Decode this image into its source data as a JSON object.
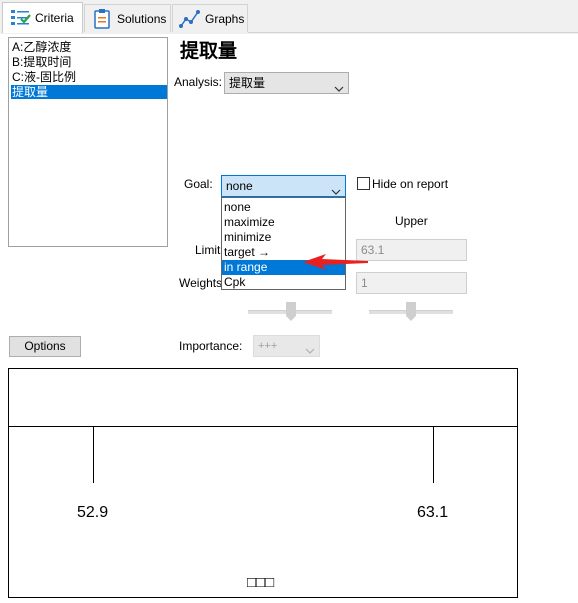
{
  "tabs": [
    {
      "label": "Criteria",
      "icon": "criteria-list-icon",
      "selected": true
    },
    {
      "label": "Solutions",
      "icon": "clipboard-icon",
      "selected": false
    },
    {
      "label": "Graphs",
      "icon": "line-graph-icon",
      "selected": false
    }
  ],
  "factors": [
    {
      "label": "A:乙醇浓度",
      "selected": false
    },
    {
      "label": "B:提取时间",
      "selected": false
    },
    {
      "label": "C:液-固比例",
      "selected": false
    },
    {
      "label": "提取量",
      "selected": true
    }
  ],
  "title": "提取量",
  "analysis": {
    "label": "Analysis:",
    "value": "提取量"
  },
  "goal": {
    "label": "Goal:",
    "value": "none",
    "options": [
      "none",
      "maximize",
      "minimize",
      "target →",
      "in range",
      "Cpk"
    ],
    "highlighted": "in range"
  },
  "hide_on_report": {
    "label": "Hide on report",
    "checked": false
  },
  "upper": {
    "header": "Upper",
    "limit": "63.1",
    "weight": "1"
  },
  "limits_label": "Limit",
  "weights_label": "Weights",
  "options_button": "Options",
  "importance": {
    "label": "Importance:",
    "value": "+++"
  },
  "graph": {
    "lower_value": "52.9",
    "upper_value": "63.1",
    "caption": "□□□"
  },
  "colors": {
    "accent": "#0078d7",
    "arrow": "#e8201f"
  }
}
